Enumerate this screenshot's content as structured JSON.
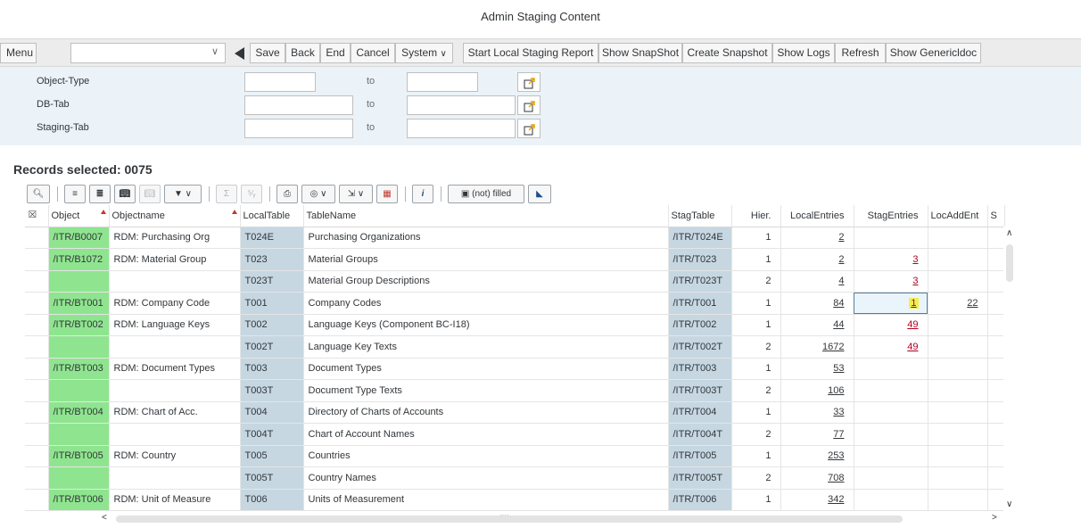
{
  "window": {
    "title": "Admin Staging Content"
  },
  "toolbar": {
    "menu": "Menu",
    "command_field_value": "",
    "buttons": [
      "Save",
      "Back",
      "End",
      "Cancel",
      "System",
      "Start Local Staging Report",
      "Show SnapShot",
      "Create Snapshot",
      "Show Logs",
      "Refresh",
      "Show Genericldoc"
    ]
  },
  "selection": {
    "rows": [
      {
        "label": "Object-Type",
        "to": "to",
        "from_value": "",
        "to_value": ""
      },
      {
        "label": "DB-Tab",
        "to": "to",
        "from_value": "",
        "to_value": ""
      },
      {
        "label": "Staging-Tab",
        "to": "to",
        "from_value": "",
        "to_value": ""
      }
    ]
  },
  "records": {
    "label": "Records selected: 0075"
  },
  "alv_toolbar": {
    "filled_label": "(not) filled",
    "sum_label": "Σ",
    "subtotal_label": "⁵⁄ᵧ"
  },
  "grid": {
    "columns": [
      "Object",
      "Objectname",
      "LocalTable",
      "TableName",
      "StagTable",
      "Hier.",
      "LocalEntries",
      "StagEntries",
      "LocAddEnt",
      "S"
    ],
    "rows": [
      [
        "/ITR/B0007",
        "RDM: Purchasing Org",
        "T024E",
        "Purchasing Organizations",
        "/ITR/T024E",
        "1",
        "2",
        "",
        ""
      ],
      [
        "/ITR/B1072",
        "RDM: Material Group",
        "T023",
        "Material Groups",
        "/ITR/T023",
        "1",
        "2",
        "3",
        ""
      ],
      [
        "",
        "",
        "T023T",
        "Material Group Descriptions",
        "/ITR/T023T",
        "2",
        "4",
        "3",
        ""
      ],
      [
        "/ITR/BT001",
        "RDM: Company Code",
        "T001",
        "Company Codes",
        "/ITR/T001",
        "1",
        "84",
        "1",
        "22"
      ],
      [
        "/ITR/BT002",
        "RDM: Language Keys",
        "T002",
        "Language Keys (Component BC-I18)",
        "/ITR/T002",
        "1",
        "44",
        "49",
        ""
      ],
      [
        "",
        "",
        "T002T",
        "Language Key Texts",
        "/ITR/T002T",
        "2",
        "1672",
        "49",
        ""
      ],
      [
        "/ITR/BT003",
        "RDM: Document Types",
        "T003",
        "Document Types",
        "/ITR/T003",
        "1",
        "53",
        "",
        ""
      ],
      [
        "",
        "",
        "T003T",
        "Document Type Texts",
        "/ITR/T003T",
        "2",
        "106",
        "",
        ""
      ],
      [
        "/ITR/BT004",
        "RDM: Chart of Acc.",
        "T004",
        "Directory of Charts of Accounts",
        "/ITR/T004",
        "1",
        "33",
        "",
        ""
      ],
      [
        "",
        "",
        "T004T",
        "Chart of Account Names",
        "/ITR/T004T",
        "2",
        "77",
        "",
        ""
      ],
      [
        "/ITR/BT005",
        "RDM: Country",
        "T005",
        "Countries",
        "/ITR/T005",
        "1",
        "253",
        "",
        ""
      ],
      [
        "",
        "",
        "T005T",
        "Country Names",
        "/ITR/T005T",
        "2",
        "708",
        "",
        ""
      ],
      [
        "/ITR/BT006",
        "RDM: Unit of Measure",
        "T006",
        "Units of Measurement",
        "/ITR/T006",
        "1",
        "342",
        "",
        ""
      ]
    ]
  },
  "scroll": {
    "hscroll_dots": "····"
  }
}
